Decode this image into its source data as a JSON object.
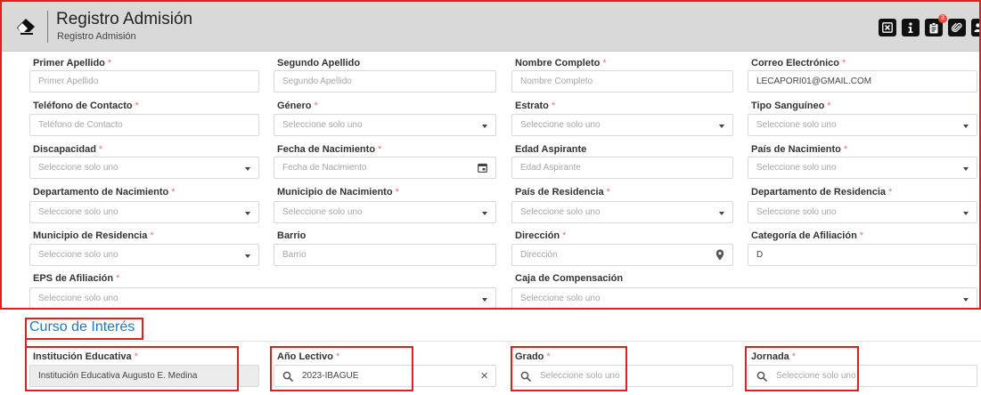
{
  "header": {
    "title": "Registro Admisión",
    "subtitle": "Registro Admisión",
    "badge_count": "3",
    "toolbar_icons": [
      "close-box-icon",
      "info-icon",
      "clipboard-icon",
      "paperclip-icon",
      "users-icon",
      "chevron-icon"
    ]
  },
  "required_mark": "*",
  "form": {
    "primer_apellido": {
      "label": "Primer Apellido",
      "placeholder": "Primer Apellido"
    },
    "segundo_apellido": {
      "label": "Segundo Apellido",
      "placeholder": "Segundo Apellido"
    },
    "nombre_completo": {
      "label": "Nombre Completo",
      "placeholder": "Nombre Completo"
    },
    "correo": {
      "label": "Correo Electrónico",
      "value": "LECAPORI01@GMAIL.COM"
    },
    "telefono": {
      "label": "Teléfono de Contacto",
      "placeholder": "Teléfono de Contacto"
    },
    "genero": {
      "label": "Género",
      "placeholder": "Seleccione solo uno"
    },
    "estrato": {
      "label": "Estrato",
      "placeholder": "Seleccione solo uno"
    },
    "tipo_sanguineo": {
      "label": "Tipo Sanguíneo",
      "placeholder": "Seleccione solo uno"
    },
    "discapacidad": {
      "label": "Discapacidad",
      "placeholder": "Seleccione solo uno"
    },
    "fecha_nacimiento": {
      "label": "Fecha de Nacimiento",
      "placeholder": "Fecha de Nacimiento"
    },
    "edad_aspirante": {
      "label": "Edad Aspirante",
      "placeholder": "Edad Aspirante"
    },
    "pais_nacimiento": {
      "label": "País de Nacimiento",
      "placeholder": "Seleccione solo uno"
    },
    "depto_nacimiento": {
      "label": "Departamento de Nacimiento",
      "placeholder": "Seleccione solo uno"
    },
    "municipio_nacimiento": {
      "label": "Municipio de Nacimiento",
      "placeholder": "Seleccione solo uno"
    },
    "pais_residencia": {
      "label": "País de Residencia",
      "placeholder": "Seleccione solo uno"
    },
    "depto_residencia": {
      "label": "Departamento de Residencia",
      "placeholder": "Seleccione solo uno"
    },
    "municipio_residencia": {
      "label": "Municipio de Residencia",
      "placeholder": "Seleccione solo uno"
    },
    "barrio": {
      "label": "Barrio",
      "placeholder": "Barrio"
    },
    "direccion": {
      "label": "Dirección",
      "placeholder": "Dirección"
    },
    "categoria_afiliacion": {
      "label": "Categoría de Afiliación",
      "value": "D"
    },
    "eps_afiliacion": {
      "label": "EPS de Afiliación",
      "placeholder": "Seleccione solo uno"
    },
    "caja_compensacion": {
      "label": "Caja de Compensación",
      "placeholder": "Seleccione solo uno"
    }
  },
  "curso": {
    "title": "Curso de Interés",
    "institucion": {
      "label": "Institución Educativa",
      "value": "Institución Educativa Augusto E. Medina"
    },
    "anio_lectivo": {
      "label": "Año Lectivo",
      "value": "2023-IBAGUE",
      "clear": "×"
    },
    "grado": {
      "label": "Grado",
      "placeholder": "Seleccione solo uno"
    },
    "jornada": {
      "label": "Jornada",
      "placeholder": "Seleccione solo uno"
    }
  }
}
